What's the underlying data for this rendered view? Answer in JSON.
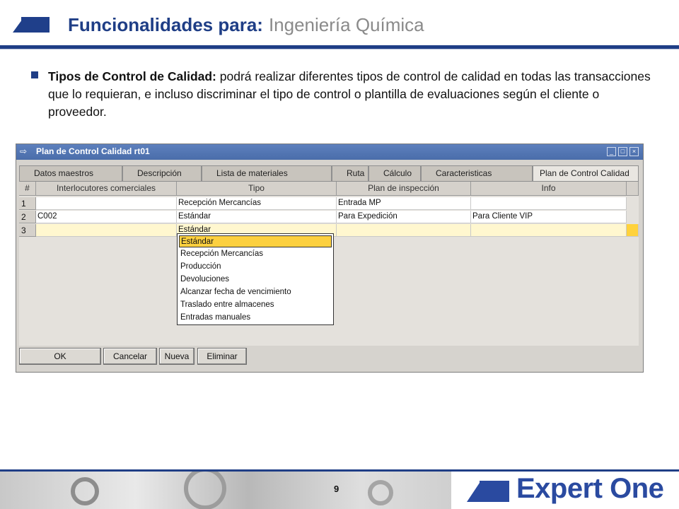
{
  "slide": {
    "title_bold": "Funcionalidades para:",
    "title_light": "Ingeniería Química",
    "bullet_bold": "Tipos de Control de Calidad:",
    "bullet_text": " podrá realizar diferentes tipos de control de calidad en todas las transacciones que lo requieran, e incluso discriminar el tipo de control o plantilla de evaluaciones según el cliente o proveedor.",
    "page_number": "9",
    "brand_name": "Expert One"
  },
  "window": {
    "title": "Plan de Control Calidad rt01",
    "tabs": [
      "Datos maestros",
      "Descripción",
      "Lista de materiales",
      "Ruta",
      "Cálculo",
      "Caracteristicas",
      "Plan de Control Calidad"
    ],
    "active_tab": "Plan de Control Calidad",
    "columns": [
      "#",
      "Interlocutores comerciales",
      "Tipo",
      "Plan de inspección",
      "Info"
    ],
    "rows": [
      {
        "num": "1",
        "interlocutor": "",
        "tipo": "Recepción Mercancías",
        "plan": "Entrada MP",
        "info": ""
      },
      {
        "num": "2",
        "interlocutor": "C002",
        "tipo": "Estándar",
        "plan": "Para Expedición",
        "info": "Para Cliente VIP"
      },
      {
        "num": "3",
        "interlocutor": "",
        "tipo": "Estándar",
        "plan": "",
        "info": ""
      }
    ],
    "dropdown_options": [
      "Estándar",
      "Recepción Mercancías",
      "Producción",
      "Devoluciones",
      "Alcanzar fecha de vencimiento",
      "Traslado entre almacenes",
      "Entradas manuales"
    ],
    "dropdown_selected": "Estándar",
    "buttons": {
      "ok": "OK",
      "cancel": "Cancelar",
      "new": "Nueva",
      "delete": "Eliminar"
    },
    "colors": {
      "titlebar": "#4f72b0",
      "selection": "#fcd03f"
    }
  }
}
